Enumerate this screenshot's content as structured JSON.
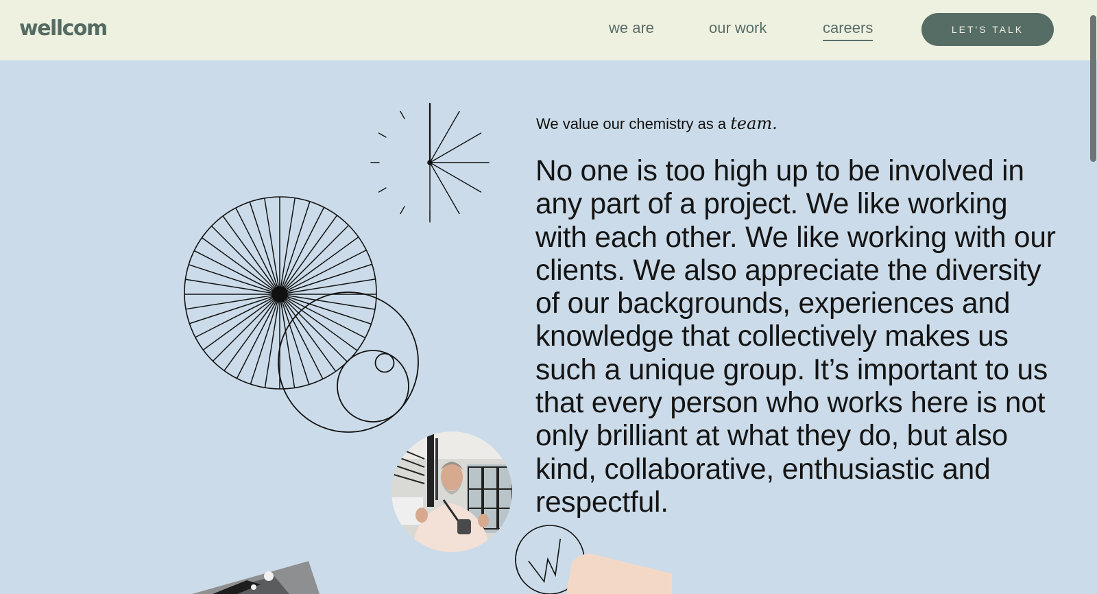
{
  "header": {
    "logo": "wellcom",
    "nav": [
      {
        "label": "we are"
      },
      {
        "label": "our work"
      },
      {
        "label": "careers",
        "active": true
      }
    ],
    "cta_label": "LET'S TALK"
  },
  "main": {
    "eyebrow_prefix": "We value our chemistry as a ",
    "eyebrow_emphasis": "team.",
    "paragraph": "No one is too high up to be involved in any part of a project. We like working with each other. We like working with our clients. We also appreciate the diversity of our backgrounds, experiences and knowledge that collectively makes us such a unique group. It’s important to us that every person who works here is not only brilliant at what they do, but also kind, collaborative, enthusiastic and respectful."
  },
  "colors": {
    "header_bg": "#eef1e0",
    "page_bg": "#cbdbe9",
    "accent": "#566d66"
  }
}
